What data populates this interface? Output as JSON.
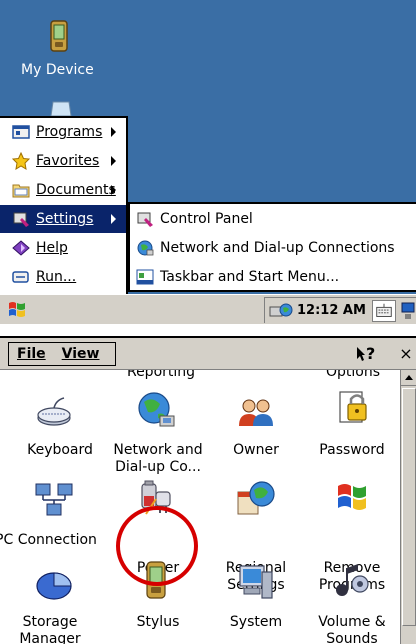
{
  "desktop": {
    "icon_label": "My Device"
  },
  "start_menu": {
    "items": [
      {
        "label": "Programs",
        "has_arrow": true,
        "icon": "programs-icon"
      },
      {
        "label": "Favorites",
        "has_arrow": true,
        "icon": "favorites-icon"
      },
      {
        "label": "Documents",
        "has_arrow": true,
        "icon": "documents-icon"
      },
      {
        "label": "Settings",
        "has_arrow": true,
        "icon": "settings-icon",
        "selected": true
      },
      {
        "label": "Help",
        "has_arrow": false,
        "icon": "help-icon"
      },
      {
        "label": "Run...",
        "has_arrow": false,
        "icon": "run-icon"
      }
    ]
  },
  "settings_submenu": {
    "items": [
      {
        "label": "Control Panel",
        "icon": "control-panel-icon"
      },
      {
        "label": "Network and Dial-up Connections",
        "icon": "network-icon"
      },
      {
        "label": "Taskbar and Start Menu...",
        "icon": "taskbar-icon"
      }
    ]
  },
  "taskbar": {
    "clock": "12:12 AM"
  },
  "control_panel": {
    "menu": {
      "file": "File",
      "view": "View"
    },
    "help_symbol": "?",
    "close_symbol": "×",
    "partial_top_labels": [
      "Reporting",
      "Options"
    ],
    "items": [
      {
        "label": "Keyboard",
        "icon": "keyboard-icon"
      },
      {
        "label": "Network and Dial-up Co...",
        "icon": "network-globe-icon"
      },
      {
        "label": "Owner",
        "icon": "owner-icon"
      },
      {
        "label": "Password",
        "icon": "password-icon"
      },
      {
        "label": "PC Connection",
        "icon": "pc-connection-icon"
      },
      {
        "label": "Power",
        "icon": "power-icon",
        "highlighted": true
      },
      {
        "label": "Regional Settings",
        "icon": "regional-settings-icon"
      },
      {
        "label": "Remove Programs",
        "icon": "remove-programs-icon"
      },
      {
        "label": "Storage Manager",
        "icon": "storage-manager-icon"
      },
      {
        "label": "Stylus",
        "icon": "stylus-icon"
      },
      {
        "label": "System",
        "icon": "system-icon"
      },
      {
        "label": "Volume & Sounds",
        "icon": "volume-sounds-icon"
      }
    ]
  },
  "colors": {
    "desktop": "#3a6ea5",
    "selection": "#0a246a",
    "highlight_circle": "#d60000",
    "chrome": "#d4d0c8"
  }
}
